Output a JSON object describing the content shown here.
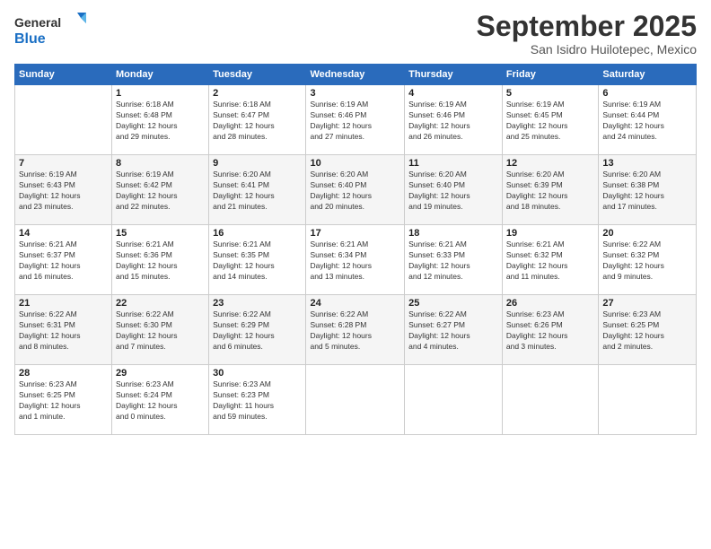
{
  "logo": {
    "line1": "General",
    "line2": "Blue"
  },
  "title": "September 2025",
  "location": "San Isidro Huilotepec, Mexico",
  "weekdays": [
    "Sunday",
    "Monday",
    "Tuesday",
    "Wednesday",
    "Thursday",
    "Friday",
    "Saturday"
  ],
  "weeks": [
    [
      {
        "day": "",
        "info": ""
      },
      {
        "day": "1",
        "info": "Sunrise: 6:18 AM\nSunset: 6:48 PM\nDaylight: 12 hours\nand 29 minutes."
      },
      {
        "day": "2",
        "info": "Sunrise: 6:18 AM\nSunset: 6:47 PM\nDaylight: 12 hours\nand 28 minutes."
      },
      {
        "day": "3",
        "info": "Sunrise: 6:19 AM\nSunset: 6:46 PM\nDaylight: 12 hours\nand 27 minutes."
      },
      {
        "day": "4",
        "info": "Sunrise: 6:19 AM\nSunset: 6:46 PM\nDaylight: 12 hours\nand 26 minutes."
      },
      {
        "day": "5",
        "info": "Sunrise: 6:19 AM\nSunset: 6:45 PM\nDaylight: 12 hours\nand 25 minutes."
      },
      {
        "day": "6",
        "info": "Sunrise: 6:19 AM\nSunset: 6:44 PM\nDaylight: 12 hours\nand 24 minutes."
      }
    ],
    [
      {
        "day": "7",
        "info": "Sunrise: 6:19 AM\nSunset: 6:43 PM\nDaylight: 12 hours\nand 23 minutes."
      },
      {
        "day": "8",
        "info": "Sunrise: 6:19 AM\nSunset: 6:42 PM\nDaylight: 12 hours\nand 22 minutes."
      },
      {
        "day": "9",
        "info": "Sunrise: 6:20 AM\nSunset: 6:41 PM\nDaylight: 12 hours\nand 21 minutes."
      },
      {
        "day": "10",
        "info": "Sunrise: 6:20 AM\nSunset: 6:40 PM\nDaylight: 12 hours\nand 20 minutes."
      },
      {
        "day": "11",
        "info": "Sunrise: 6:20 AM\nSunset: 6:40 PM\nDaylight: 12 hours\nand 19 minutes."
      },
      {
        "day": "12",
        "info": "Sunrise: 6:20 AM\nSunset: 6:39 PM\nDaylight: 12 hours\nand 18 minutes."
      },
      {
        "day": "13",
        "info": "Sunrise: 6:20 AM\nSunset: 6:38 PM\nDaylight: 12 hours\nand 17 minutes."
      }
    ],
    [
      {
        "day": "14",
        "info": "Sunrise: 6:21 AM\nSunset: 6:37 PM\nDaylight: 12 hours\nand 16 minutes."
      },
      {
        "day": "15",
        "info": "Sunrise: 6:21 AM\nSunset: 6:36 PM\nDaylight: 12 hours\nand 15 minutes."
      },
      {
        "day": "16",
        "info": "Sunrise: 6:21 AM\nSunset: 6:35 PM\nDaylight: 12 hours\nand 14 minutes."
      },
      {
        "day": "17",
        "info": "Sunrise: 6:21 AM\nSunset: 6:34 PM\nDaylight: 12 hours\nand 13 minutes."
      },
      {
        "day": "18",
        "info": "Sunrise: 6:21 AM\nSunset: 6:33 PM\nDaylight: 12 hours\nand 12 minutes."
      },
      {
        "day": "19",
        "info": "Sunrise: 6:21 AM\nSunset: 6:32 PM\nDaylight: 12 hours\nand 11 minutes."
      },
      {
        "day": "20",
        "info": "Sunrise: 6:22 AM\nSunset: 6:32 PM\nDaylight: 12 hours\nand 9 minutes."
      }
    ],
    [
      {
        "day": "21",
        "info": "Sunrise: 6:22 AM\nSunset: 6:31 PM\nDaylight: 12 hours\nand 8 minutes."
      },
      {
        "day": "22",
        "info": "Sunrise: 6:22 AM\nSunset: 6:30 PM\nDaylight: 12 hours\nand 7 minutes."
      },
      {
        "day": "23",
        "info": "Sunrise: 6:22 AM\nSunset: 6:29 PM\nDaylight: 12 hours\nand 6 minutes."
      },
      {
        "day": "24",
        "info": "Sunrise: 6:22 AM\nSunset: 6:28 PM\nDaylight: 12 hours\nand 5 minutes."
      },
      {
        "day": "25",
        "info": "Sunrise: 6:22 AM\nSunset: 6:27 PM\nDaylight: 12 hours\nand 4 minutes."
      },
      {
        "day": "26",
        "info": "Sunrise: 6:23 AM\nSunset: 6:26 PM\nDaylight: 12 hours\nand 3 minutes."
      },
      {
        "day": "27",
        "info": "Sunrise: 6:23 AM\nSunset: 6:25 PM\nDaylight: 12 hours\nand 2 minutes."
      }
    ],
    [
      {
        "day": "28",
        "info": "Sunrise: 6:23 AM\nSunset: 6:25 PM\nDaylight: 12 hours\nand 1 minute."
      },
      {
        "day": "29",
        "info": "Sunrise: 6:23 AM\nSunset: 6:24 PM\nDaylight: 12 hours\nand 0 minutes."
      },
      {
        "day": "30",
        "info": "Sunrise: 6:23 AM\nSunset: 6:23 PM\nDaylight: 11 hours\nand 59 minutes."
      },
      {
        "day": "",
        "info": ""
      },
      {
        "day": "",
        "info": ""
      },
      {
        "day": "",
        "info": ""
      },
      {
        "day": "",
        "info": ""
      }
    ]
  ]
}
